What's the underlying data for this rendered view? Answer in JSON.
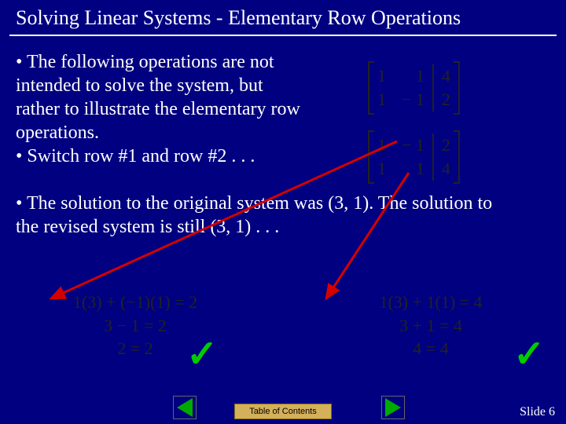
{
  "title": "Solving Linear Systems - Elementary Row Operations",
  "bullets": {
    "b1": "• The following operations are not intended to solve the system, but rather to illustrate the elementary row operations.",
    "b2": "• Switch row #1 and row #2 . . .",
    "b3": "• The solution to the original system was (3, 1).  The solution to the revised system is still (3, 1) . . ."
  },
  "matrix1": {
    "r1c1": "1",
    "r1c2": "1",
    "r1c3": "4",
    "r2c1": "1",
    "r2c2": "− 1",
    "r2c3": "2"
  },
  "matrix2": {
    "r1c1": "1",
    "r1c2": "− 1",
    "r1c3": "2",
    "r2c1": "1",
    "r2c2": "1",
    "r2c3": "4"
  },
  "work_left": {
    "line1": "1(3) + (−1)(1) = 2",
    "line2": "3 − 1 = 2",
    "line3": "2 = 2"
  },
  "work_right": {
    "line1": "1(3) + 1(1) = 4",
    "line2": "3 + 1 = 4",
    "line3": "4 = 4"
  },
  "footer": {
    "toc": "Table of Contents",
    "slide": "Slide 6"
  }
}
